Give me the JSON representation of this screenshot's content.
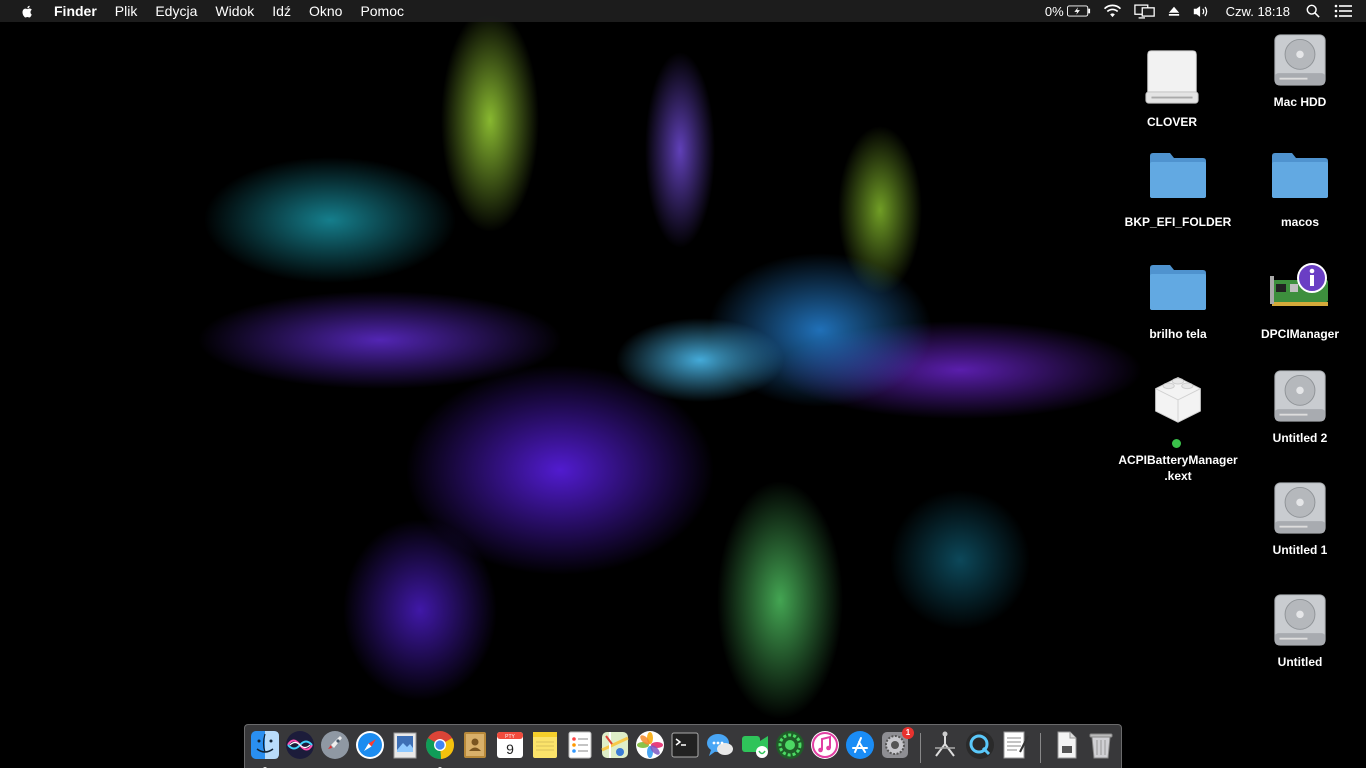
{
  "menubar": {
    "app_name": "Finder",
    "items": [
      "Plik",
      "Edycja",
      "Widok",
      "Idź",
      "Okno",
      "Pomoc"
    ],
    "battery_percent": "0%",
    "clock": "Czw. 18:18"
  },
  "desktop": {
    "icons": {
      "clover": "CLOVER",
      "mac_hdd": "Mac HDD",
      "bkp_efi": "BKP_EFI_FOLDER",
      "macos": "macos",
      "brilho": "brilho tela",
      "dpci": "DPCIManager",
      "acpi": "ACPIBatteryManager.kext",
      "untitled2": "Untitled 2",
      "untitled1": "Untitled 1",
      "untitled": "Untitled"
    }
  },
  "dock": {
    "calendar_month": "PTY",
    "calendar_day": "9",
    "sysprefs_badge": "1",
    "apps": [
      "finder",
      "siri",
      "launchpad",
      "safari",
      "preview",
      "chrome",
      "contacts",
      "calendar",
      "notes",
      "reminders",
      "maps",
      "photos",
      "terminal",
      "messages",
      "facetime",
      "app-green",
      "itunes",
      "app-store",
      "system-preferences",
      "clover-configurator",
      "quicktime",
      "textedit",
      "document",
      "trash"
    ]
  },
  "colors": {
    "folder": "#5aa2dc",
    "accent_green": "#3ac24a",
    "menubar_bg": "#1e1e1e"
  }
}
